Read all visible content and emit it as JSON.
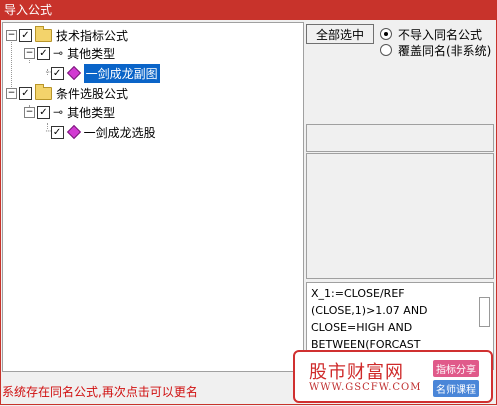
{
  "window": {
    "title": "导入公式",
    "accent": "#c8332b"
  },
  "tree": {
    "nodes": [
      {
        "label": "技术指标公式",
        "level": 0,
        "checked": true,
        "expanded": true,
        "icon": "folder-icon"
      },
      {
        "label": "其他类型",
        "level": 1,
        "checked": true,
        "expanded": true,
        "icon": "key-icon"
      },
      {
        "label": "一剑成龙副图",
        "level": 2,
        "checked": true,
        "icon": "formula-gem-icon",
        "selected": true
      },
      {
        "label": "条件选股公式",
        "level": 0,
        "checked": true,
        "expanded": true,
        "icon": "folder-icon"
      },
      {
        "label": "其他类型",
        "level": 1,
        "checked": true,
        "expanded": true,
        "icon": "key-icon"
      },
      {
        "label": "一剑成龙选股",
        "level": 2,
        "checked": true,
        "icon": "formula-gem-icon"
      }
    ]
  },
  "actions": {
    "select_all_label": "全部选中",
    "radio_options": [
      {
        "label": "不导入同名公式",
        "selected": true
      },
      {
        "label": "覆盖同名(非系统)",
        "selected": false
      }
    ]
  },
  "formula_preview": {
    "lines": [
      "X_1:=CLOSE/REF",
      "(CLOSE,1)>1.07 AND",
      "CLOSE=HIGH AND",
      "BETWEEN(FORCAST"
    ]
  },
  "status": {
    "message": "系统存在同名公式,再次点击可以更名",
    "color": "#d01010"
  },
  "watermark": {
    "name": "股市财富网",
    "url": "WWW.GSCFW.COM",
    "tag_top": "指标分享",
    "tag_bottom": "名师课程"
  }
}
